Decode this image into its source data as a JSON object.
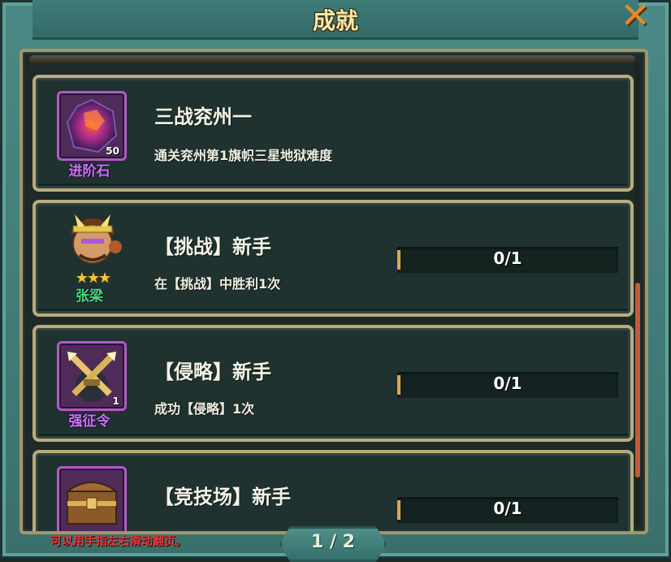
{
  "window": {
    "title": "成就"
  },
  "achievements": [
    {
      "title": "三战兖州一",
      "desc": "通关兖州第1旗帜三星地狱难度",
      "reward": {
        "name": "进阶石",
        "qty": "50",
        "icon": "purple-gem-icon",
        "name_color": "#c873ff"
      },
      "progress": null
    },
    {
      "title": "【挑战】新手",
      "desc": "在【挑战】中胜利1次",
      "reward": {
        "name": "张梁",
        "qty": "",
        "icon": "hero-portrait-icon",
        "name_color": "#3fe07a",
        "stars": "★★★"
      },
      "progress": {
        "text": "0/1",
        "fraction": 0
      }
    },
    {
      "title": "【侵略】新手",
      "desc": "成功【侵略】1次",
      "reward": {
        "name": "强征令",
        "qty": "1",
        "icon": "crossed-swords-icon",
        "name_color": "#c873ff"
      },
      "progress": {
        "text": "0/1",
        "fraction": 0
      }
    },
    {
      "title": "【竞技场】新手",
      "desc": "",
      "reward": {
        "name": "",
        "qty": "",
        "icon": "treasure-chest-icon",
        "name_color": "#c873ff"
      },
      "progress": {
        "text": "0/1",
        "fraction": 0
      }
    }
  ],
  "footer": {
    "hint": "可以用手指左右滑动翻页。",
    "page": "1 / 2"
  }
}
